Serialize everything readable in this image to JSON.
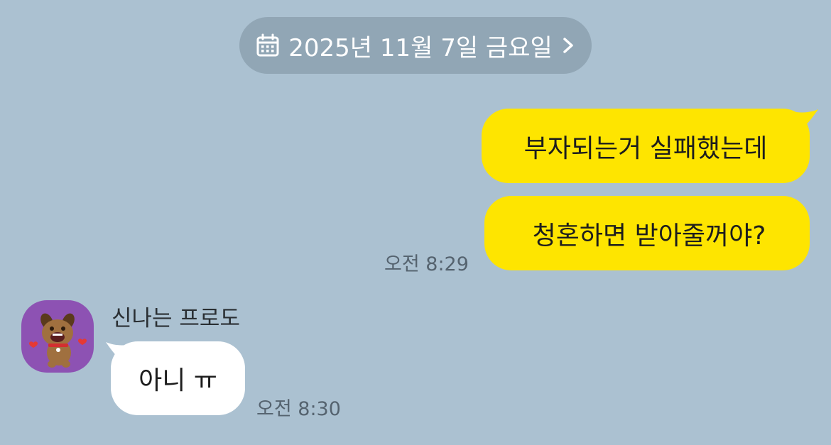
{
  "date_divider": {
    "label": "2025년 11월 7일 금요일",
    "icon": "calendar-icon",
    "chevron": "chevron-right-icon"
  },
  "messages": [
    {
      "text": "부자되는거 실패했는데"
    },
    {
      "text": "청혼하면 받아줄꺼야?",
      "time": "오전 8:29"
    },
    {
      "sender": "신나는 프로도",
      "text": "아니 ㅠ",
      "time": "오전 8:30"
    }
  ],
  "colors": {
    "background": "#abc1d1",
    "my_bubble": "#fee500",
    "their_bubble": "#ffffff",
    "date_pill": "#91a6b5"
  }
}
